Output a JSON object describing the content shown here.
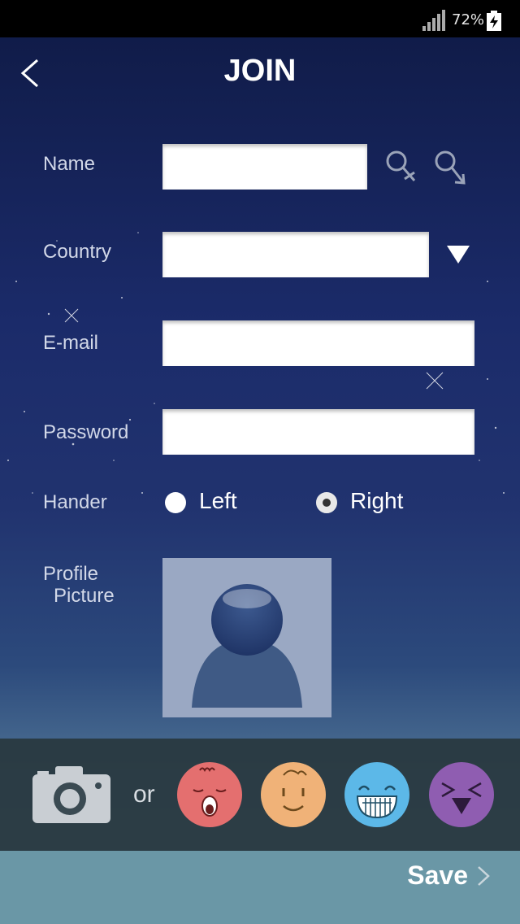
{
  "status_bar": {
    "battery_percent": "72%",
    "icons": [
      "signal-icon",
      "battery-charging-icon"
    ]
  },
  "header": {
    "title": "JOIN",
    "back_icon": "chevron-left-icon"
  },
  "form": {
    "name": {
      "label": "Name",
      "value": "",
      "gender_icons": [
        "female-icon",
        "male-icon"
      ]
    },
    "country": {
      "label": "Country",
      "value": "",
      "dropdown_icon": "triangle-down-icon"
    },
    "email": {
      "label": "E-mail",
      "value": ""
    },
    "password": {
      "label": "Password",
      "value": ""
    },
    "hander": {
      "label": "Hander",
      "options": [
        "Left",
        "Right"
      ],
      "selected": "Right"
    },
    "profile_picture": {
      "label_line1": "Profile",
      "label_line2": "Picture",
      "placeholder_icon": "person-silhouette-icon"
    }
  },
  "picture_sources": {
    "camera_icon": "camera-icon",
    "or_text": "or",
    "avatars": [
      {
        "icon": "avatar-face-red",
        "color": "#e46f6f"
      },
      {
        "icon": "avatar-face-orange",
        "color": "#f0b278"
      },
      {
        "icon": "avatar-face-blue",
        "color": "#5cb8e8"
      },
      {
        "icon": "avatar-face-purple",
        "color": "#8f5db1"
      }
    ]
  },
  "footer": {
    "save_label": "Save",
    "save_icon": "chevron-right-icon"
  }
}
